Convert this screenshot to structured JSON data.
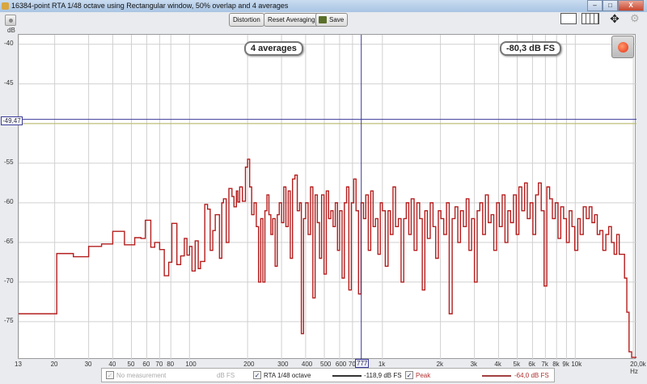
{
  "window": {
    "title": "16384-point RTA 1/48 octave using Rectangular window, 50% overlap and 4 averages",
    "minimize": "–",
    "maximize": "□",
    "close": "X"
  },
  "toolbar": {
    "distortion": "Distortion",
    "reset": "Reset Averaging",
    "save": "Save"
  },
  "overlay": {
    "averages": "4 averages",
    "level": "-80,3 dB FS",
    "cursor_value": "-49,47",
    "cursor_freq": "777"
  },
  "legend": {
    "items": [
      {
        "label": "No measurement",
        "unit": "dB FS",
        "checked": false,
        "enabled": false
      },
      {
        "label": "RTA 1/48 octave",
        "value": "-118,9 dB FS",
        "checked": true,
        "color": "#333333"
      },
      {
        "label": "Peak",
        "value": "-64,0 dB FS",
        "checked": true,
        "color": "#b03030"
      }
    ]
  },
  "colors": {
    "trace": "#b41e1e",
    "cursor": "#3a3a9a",
    "level_line": "#b8b860",
    "grid": "#d0d0d0"
  },
  "chart_data": {
    "type": "line",
    "xscale": "log",
    "ylabel": "dB",
    "xunit": "Hz",
    "xlim": [
      13,
      20500
    ],
    "ylim": [
      -79.8,
      -38.8
    ],
    "yticks": [
      -40,
      -45,
      -50,
      -55,
      -60,
      -65,
      -70,
      -75
    ],
    "ytick_labels": [
      "-40",
      "-45",
      "-50",
      "-55",
      "-60",
      "-65",
      "-70",
      "-75"
    ],
    "xticks": [
      13,
      20,
      30,
      40,
      50,
      60,
      70,
      80,
      100,
      200,
      300,
      400,
      500,
      600,
      700,
      1000,
      2000,
      3000,
      4000,
      5000,
      6000,
      7000,
      8000,
      9000,
      10000,
      20000
    ],
    "xtick_labels": [
      "13",
      "20",
      "30",
      "40",
      "50",
      "60",
      "70",
      "80",
      "100",
      "200",
      "300",
      "400",
      "500",
      "600",
      "700",
      "1k",
      "2k",
      "3k",
      "4k",
      "5k",
      "6k",
      "7k",
      "8k",
      "9k",
      "10k",
      "20,0k Hz"
    ],
    "cursor": {
      "freq_hz": 777,
      "db": -49.47
    },
    "level_line_db": -50.0,
    "series": [
      {
        "name": "RTA 1/48 octave",
        "step": true,
        "points": [
          [
            13,
            -74
          ],
          [
            20.5,
            -66.4
          ],
          [
            25,
            -66.8
          ],
          [
            30,
            -65.5
          ],
          [
            35,
            -65.2
          ],
          [
            40,
            -63.6
          ],
          [
            46,
            -65.3
          ],
          [
            52,
            -64.4
          ],
          [
            56,
            -64.5
          ],
          [
            59,
            -62.2
          ],
          [
            63,
            -65.6
          ],
          [
            66,
            -65.0
          ],
          [
            70,
            -65.9
          ],
          [
            74,
            -69.2
          ],
          [
            78,
            -67.5
          ],
          [
            81,
            -62.6
          ],
          [
            86,
            -67.8
          ],
          [
            90,
            -66.7
          ],
          [
            94,
            -64.5
          ],
          [
            97,
            -66.6
          ],
          [
            100,
            -65.5
          ],
          [
            103,
            -68.6
          ],
          [
            107,
            -64.8
          ],
          [
            111,
            -68.3
          ],
          [
            114,
            -67.4
          ],
          [
            120,
            -60.2
          ],
          [
            124,
            -60.8
          ],
          [
            128,
            -66.0
          ],
          [
            132,
            -63.5
          ],
          [
            136,
            -61.5
          ],
          [
            140,
            -61.5
          ],
          [
            143,
            -67.0
          ],
          [
            147,
            -60.0
          ],
          [
            150,
            -59.5
          ],
          [
            155,
            -65.0
          ],
          [
            160,
            -58.2
          ],
          [
            166,
            -59.2
          ],
          [
            170,
            -60.5
          ],
          [
            175,
            -58.5
          ],
          [
            178,
            -59.9
          ],
          [
            182,
            -58.0
          ],
          [
            188,
            -59.8
          ],
          [
            195,
            -55.5
          ],
          [
            200,
            -54.5
          ],
          [
            205,
            -58.0
          ],
          [
            210,
            -61.5
          ],
          [
            216,
            -60.0
          ],
          [
            222,
            -63.0
          ],
          [
            228,
            -70.0
          ],
          [
            234,
            -62.0
          ],
          [
            240,
            -70.0
          ],
          [
            246,
            -61.0
          ],
          [
            252,
            -59.0
          ],
          [
            258,
            -61.5
          ],
          [
            264,
            -64.0
          ],
          [
            270,
            -62.0
          ],
          [
            278,
            -68.0
          ],
          [
            285,
            -61.5
          ],
          [
            292,
            -60.0
          ],
          [
            300,
            -62.5
          ],
          [
            308,
            -58.0
          ],
          [
            316,
            -63.0
          ],
          [
            325,
            -58.5
          ],
          [
            333,
            -67.0
          ],
          [
            342,
            -57.0
          ],
          [
            352,
            -56.5
          ],
          [
            362,
            -61.0
          ],
          [
            372,
            -60.0
          ],
          [
            380,
            -76.5
          ],
          [
            390,
            -62.0
          ],
          [
            400,
            -60.0
          ],
          [
            412,
            -64.0
          ],
          [
            424,
            -58.0
          ],
          [
            436,
            -72.0
          ],
          [
            448,
            -59.0
          ],
          [
            460,
            -62.5
          ],
          [
            472,
            -67.0
          ],
          [
            484,
            -59.0
          ],
          [
            498,
            -69.0
          ],
          [
            512,
            -58.5
          ],
          [
            526,
            -62.0
          ],
          [
            540,
            -61.0
          ],
          [
            555,
            -63.0
          ],
          [
            570,
            -60.0
          ],
          [
            585,
            -66.0
          ],
          [
            600,
            -61.0
          ],
          [
            618,
            -69.5
          ],
          [
            635,
            -60.0
          ],
          [
            652,
            -58.0
          ],
          [
            670,
            -71.0
          ],
          [
            690,
            -60.0
          ],
          [
            710,
            -57.0
          ],
          [
            730,
            -61.0
          ],
          [
            752,
            -71.5
          ],
          [
            775,
            -60.0
          ],
          [
            798,
            -62.0
          ],
          [
            820,
            -59.0
          ],
          [
            845,
            -66.0
          ],
          [
            870,
            -58.5
          ],
          [
            895,
            -63.0
          ],
          [
            920,
            -62.0
          ],
          [
            948,
            -66.5
          ],
          [
            975,
            -60.0
          ],
          [
            1000,
            -61.0
          ],
          [
            1035,
            -68.0
          ],
          [
            1070,
            -61.0
          ],
          [
            1100,
            -64.0
          ],
          [
            1135,
            -58.0
          ],
          [
            1170,
            -63.0
          ],
          [
            1210,
            -62.0
          ],
          [
            1250,
            -70.0
          ],
          [
            1290,
            -62.0
          ],
          [
            1330,
            -60.0
          ],
          [
            1370,
            -64.0
          ],
          [
            1410,
            -59.5
          ],
          [
            1460,
            -66.0
          ],
          [
            1510,
            -60.0
          ],
          [
            1560,
            -62.0
          ],
          [
            1610,
            -71.0
          ],
          [
            1660,
            -61.0
          ],
          [
            1710,
            -64.5
          ],
          [
            1770,
            -60.0
          ],
          [
            1830,
            -63.0
          ],
          [
            1890,
            -67.0
          ],
          [
            1950,
            -61.0
          ],
          [
            2010,
            -62.0
          ],
          [
            2080,
            -64.0
          ],
          [
            2150,
            -60.0
          ],
          [
            2220,
            -74.0
          ],
          [
            2300,
            -62.0
          ],
          [
            2380,
            -60.5
          ],
          [
            2460,
            -65.0
          ],
          [
            2540,
            -61.0
          ],
          [
            2630,
            -63.0
          ],
          [
            2720,
            -59.5
          ],
          [
            2810,
            -66.0
          ],
          [
            2900,
            -62.0
          ],
          [
            3000,
            -70.0
          ],
          [
            3100,
            -61.0
          ],
          [
            3200,
            -60.0
          ],
          [
            3310,
            -64.0
          ],
          [
            3420,
            -59.0
          ],
          [
            3540,
            -62.5
          ],
          [
            3660,
            -61.5
          ],
          [
            3780,
            -66.0
          ],
          [
            3910,
            -60.0
          ],
          [
            4040,
            -63.0
          ],
          [
            4180,
            -59.0
          ],
          [
            4320,
            -65.0
          ],
          [
            4470,
            -61.0
          ],
          [
            4620,
            -62.5
          ],
          [
            4780,
            -59.0
          ],
          [
            4940,
            -64.0
          ],
          [
            5100,
            -58.0
          ],
          [
            5280,
            -61.0
          ],
          [
            5460,
            -57.5
          ],
          [
            5640,
            -62.0
          ],
          [
            5830,
            -60.0
          ],
          [
            6030,
            -64.0
          ],
          [
            6230,
            -59.0
          ],
          [
            6440,
            -57.5
          ],
          [
            6660,
            -61.0
          ],
          [
            6890,
            -70.5
          ],
          [
            7120,
            -58.0
          ],
          [
            7360,
            -59.5
          ],
          [
            7610,
            -62.0
          ],
          [
            7870,
            -60.0
          ],
          [
            8140,
            -64.5
          ],
          [
            8410,
            -60.5
          ],
          [
            8700,
            -62.0
          ],
          [
            9000,
            -65.0
          ],
          [
            9300,
            -61.0
          ],
          [
            9610,
            -63.0
          ],
          [
            9940,
            -66.0
          ],
          [
            10300,
            -62.0
          ],
          [
            10600,
            -64.0
          ],
          [
            11000,
            -60.5
          ],
          [
            11400,
            -62.0
          ],
          [
            11800,
            -60.5
          ],
          [
            12200,
            -62.5
          ],
          [
            12600,
            -61.5
          ],
          [
            13000,
            -64.0
          ],
          [
            13400,
            -63.5
          ],
          [
            13900,
            -66.0
          ],
          [
            14400,
            -64.0
          ],
          [
            14900,
            -63.0
          ],
          [
            15400,
            -65.0
          ],
          [
            15900,
            -66.5
          ],
          [
            16400,
            -64.0
          ],
          [
            16900,
            -66.5
          ],
          [
            17500,
            -66.5
          ],
          [
            18000,
            -69.5
          ],
          [
            18500,
            -73.8
          ],
          [
            19000,
            -78.8
          ],
          [
            19600,
            -79.5
          ],
          [
            20500,
            -79.5
          ]
        ]
      }
    ]
  }
}
